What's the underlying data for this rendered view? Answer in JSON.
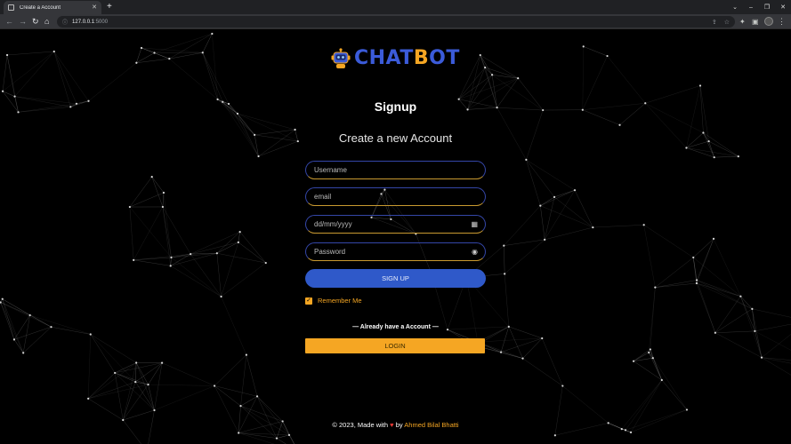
{
  "browser": {
    "tab_title": "Create a Account",
    "new_tab": "+",
    "url_host": "127.0.0.1",
    "url_port": ":5000",
    "window_controls": [
      "⌄",
      "–",
      "❐",
      "✕"
    ]
  },
  "logo": {
    "icon": "robot-icon",
    "text_prefix": "CHAT",
    "text_o": "B",
    "text_suffix": "OT",
    "colors": {
      "primary": "#3b5bd9",
      "accent": "#f5a623"
    }
  },
  "form": {
    "heading": "Signup",
    "subheading": "Create a new Account",
    "username_placeholder": "Username",
    "email_placeholder": "email",
    "date_placeholder": "dd/mm/yyyy",
    "password_placeholder": "Password",
    "signup_label": "SIGN UP",
    "remember_label": "Remember Me",
    "remember_checked": true
  },
  "login": {
    "prompt": "— Already have a Account —",
    "button_label": "LOGIN"
  },
  "footer": {
    "prefix": "© 2023, Made with",
    "heart": "♥",
    "by": "by",
    "author": "Ahmed Bilal Bhatti"
  }
}
